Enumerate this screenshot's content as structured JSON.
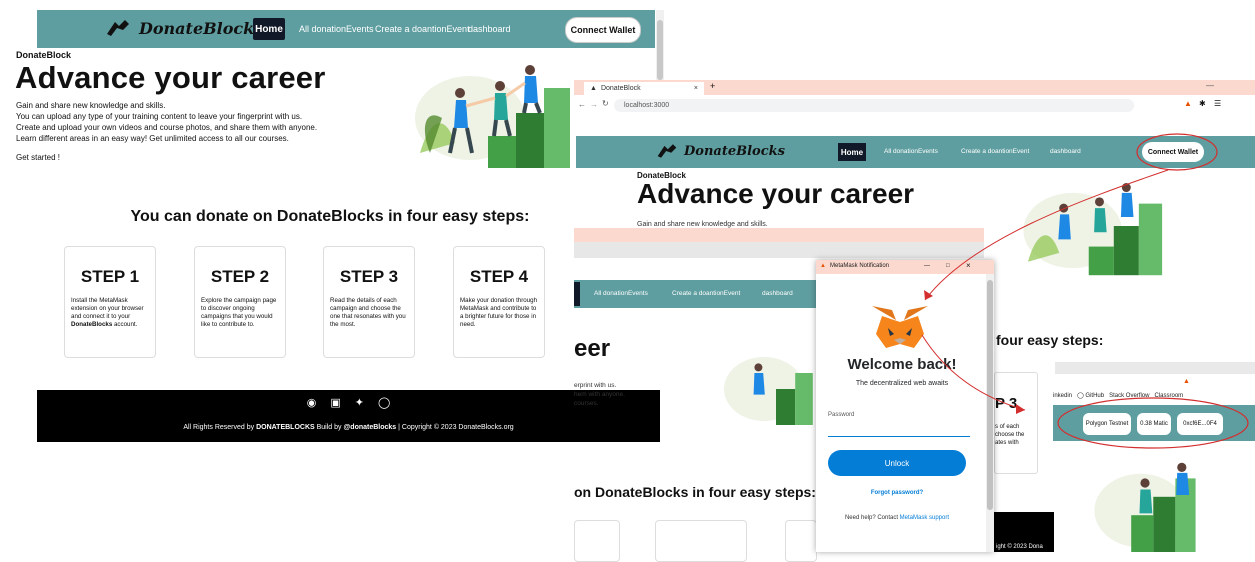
{
  "left_page": {
    "brand": "DonateBlocks",
    "nav": {
      "home": "Home",
      "events": "All donationEvents",
      "create": "Create a doantionEvent",
      "dashboard": "dashboard",
      "connect": "Connect Wallet"
    },
    "crumb": "DonateBlock",
    "hero_title": "Advance your career",
    "hero_lines": [
      "Gain and share new knowledge and skills.",
      "You can upload any type of your training content to leave your fingerprint with us.",
      "Create and upload your own videos and course photos, and share them with anyone.",
      "Learn different areas in an easy way! Get unlimited access to all our courses."
    ],
    "started": "Get started !",
    "steps_title": "You can donate on DonateBlocks in four easy steps:",
    "steps": [
      {
        "title": "STEP 1",
        "desc_pre": "Install the MetaMask extension on your browser and connect it to your ",
        "desc_bold": "DonateBlocks",
        "desc_post": " account."
      },
      {
        "title": "STEP 2",
        "desc_pre": "Explore the campaign page to discover ongoing campaigns that you would like to contribute to.",
        "desc_bold": "",
        "desc_post": ""
      },
      {
        "title": "STEP 3",
        "desc_pre": "Read the details of each campaign and choose the one that resonates with you the most.",
        "desc_bold": "",
        "desc_post": ""
      },
      {
        "title": "STEP 4",
        "desc_pre": "Make your donation through MetaMask and contribute to a brighter future for those in need.",
        "desc_bold": "",
        "desc_post": ""
      }
    ],
    "footer": {
      "prefix": "All Rights Reserved by ",
      "brand": "DONATEBLOCKS",
      "mid": " Build by ",
      "author": "@donateBlocks",
      "suffix": " | Copyright © 2023 DonateBlocks.org"
    }
  },
  "right_page": {
    "tab_title": "DonateBlock",
    "url": "localhost:3000",
    "brand": "DonateBlocks",
    "nav": {
      "home": "Home",
      "events": "All donationEvents",
      "create": "Create a doantionEvent",
      "dashboard": "dashboard",
      "connect": "Connect Wallet"
    },
    "crumb": "DonateBlock",
    "hero_title": "Advance your career",
    "hero_sub": "Gain and share new knowledge and skills.",
    "middle": {
      "nav_events": "All donationEvents",
      "nav_create": "Create a doantionEvent",
      "nav_dashboard": "dashboard",
      "big": "eer",
      "lines": [
        "erprint with us.",
        "hem with anyone.",
        "courses."
      ],
      "steps": "on DonateBlocks in four easy steps:"
    },
    "four_easy": "four easy steps:",
    "step3_title": "P 3",
    "step3_text": [
      "s of each",
      "choose the",
      "ates with"
    ],
    "bookmarks": [
      "inkedin",
      "GitHub",
      "Stack Overflow",
      "Classroom"
    ],
    "wallet": {
      "network": "Polygon Testnet",
      "balance": "0.38 Matic",
      "address": "0xcf6E...0F4"
    },
    "foot_snip": "ight © 2023 Dona"
  },
  "metamask": {
    "window_title": "MetaMask Notification",
    "welcome": "Welcome back!",
    "tagline": "The decentralized web awaits",
    "password_label": "Password",
    "unlock": "Unlock",
    "forgot": "Forgot password?",
    "help_prefix": "Need help? Contact ",
    "help_link": "MetaMask support"
  },
  "colors": {
    "nav": "#5f9ea0",
    "accent_blue": "#037dd6",
    "annotation": "#d32f2f",
    "footer": "#000000"
  }
}
